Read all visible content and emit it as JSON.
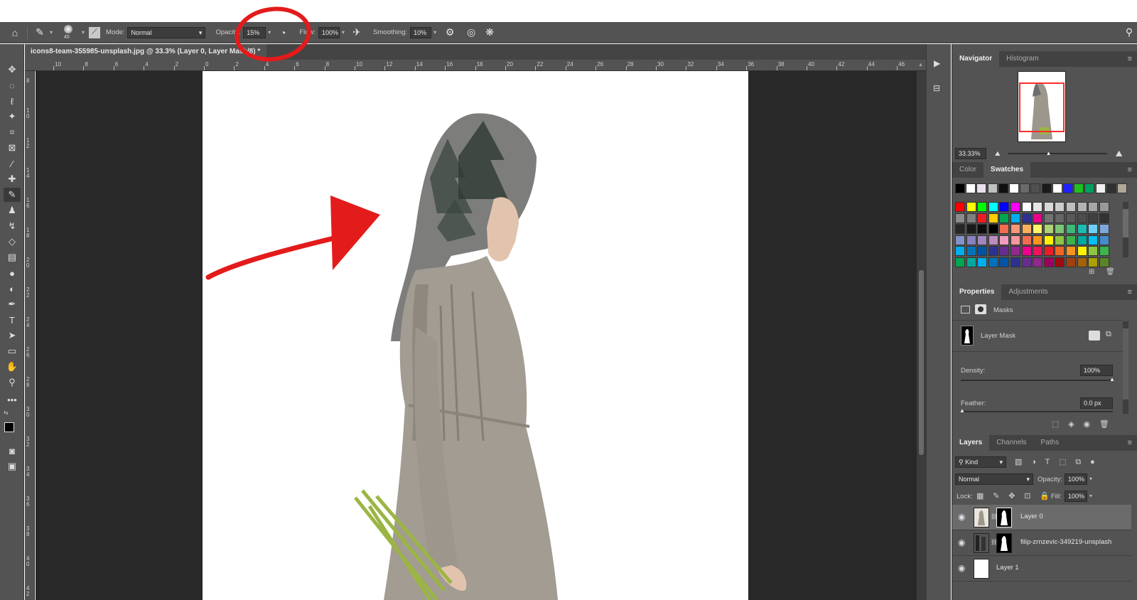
{
  "options_bar": {
    "brush_size": "45",
    "mode_label": "Mode:",
    "mode_value": "Normal",
    "opacity_label": "Opacity:",
    "opacity_value": "15%",
    "flow_label": "Flow:",
    "flow_value": "100%",
    "smoothing_label": "Smoothing:",
    "smoothing_value": "10%"
  },
  "document": {
    "tab_title": "icons8-team-355985-unsplash.jpg @ 33.3% (Layer 0, Layer Mask/8) *",
    "close_glyph": "×"
  },
  "ruler": {
    "h_ticks": [
      "10",
      "8",
      "6",
      "4",
      "2",
      "0",
      "2",
      "4",
      "6",
      "8",
      "10",
      "12",
      "14",
      "16",
      "18",
      "20",
      "22",
      "24",
      "26",
      "28",
      "30",
      "32",
      "34",
      "36",
      "38",
      "40",
      "42",
      "44",
      "46"
    ],
    "v_ticks": [
      "8",
      "1 0",
      "1 2",
      "1 4",
      "1 6",
      "1 8",
      "2 0",
      "2 2",
      "2 4",
      "2 6",
      "2 8",
      "3 0",
      "3 2",
      "3 4",
      "3 6",
      "3 8",
      "4 0",
      "4 2"
    ]
  },
  "navigator": {
    "tabs": [
      "Navigator",
      "Histogram"
    ],
    "zoom": "33.33%"
  },
  "color_panel": {
    "tabs": [
      "Color",
      "Swatches"
    ],
    "recent": [
      "#000000",
      "#ffffff",
      "#e8e0ea",
      "#c0c0c0",
      "#101010",
      "#ffffff",
      "#6a6a6a",
      "#505050",
      "#1a1a1a",
      "#ffffff",
      "#2020ff",
      "#20c020",
      "#00a060",
      "#f0f0f0",
      "#303030",
      "#b0a898"
    ],
    "grid": [
      [
        "#ff0000",
        "#ffff00",
        "#00ff00",
        "#00ffff",
        "#0000ff",
        "#ff00ff",
        "#ffffff",
        "#e6e6e6",
        "#d9d9d9",
        "#cccccc",
        "#bfbfbf",
        "#b3b3b3",
        "#a6a6a6",
        "#999999"
      ],
      [
        "#8c8c8c",
        "#808080",
        "#ed1c24",
        "#ffcc00",
        "#00a651",
        "#00aeef",
        "#2e3192",
        "#ec008c",
        "#737373",
        "#666666",
        "#595959",
        "#4d4d4d",
        "#404040",
        "#333333"
      ],
      [
        "#262626",
        "#1a1a1a",
        "#0d0d0d",
        "#000000",
        "#f26c4f",
        "#f69679",
        "#fbaf5d",
        "#fff568",
        "#acd373",
        "#7cc576",
        "#3cb878",
        "#1cbbb4",
        "#6dcff6",
        "#7da7d9"
      ],
      [
        "#8393ca",
        "#8781bd",
        "#a186be",
        "#bd8cbf",
        "#f49ac1",
        "#f5989d",
        "#f26c4f",
        "#f7941d",
        "#fff200",
        "#8dc63f",
        "#39b54a",
        "#00a99d",
        "#00bff3",
        "#448ccb"
      ],
      [
        "#00aeef",
        "#0072bc",
        "#0054a6",
        "#2e3192",
        "#662d91",
        "#92278f",
        "#ec008c",
        "#ed145b",
        "#ed1c24",
        "#f26522",
        "#f7941d",
        "#fff200",
        "#8dc63f",
        "#39b54a"
      ],
      [
        "#00a651",
        "#00a99d",
        "#00aeef",
        "#0072bc",
        "#0054a6",
        "#2e3192",
        "#662d91",
        "#92278f",
        "#9e005d",
        "#9e0b0f",
        "#a0410d",
        "#a36209",
        "#aba000",
        "#598527"
      ]
    ]
  },
  "properties": {
    "tabs": [
      "Properties",
      "Adjustments"
    ],
    "masks_label": "Masks",
    "layer_mask_label": "Layer Mask",
    "density_label": "Density:",
    "density_value": "100%",
    "feather_label": "Feather:",
    "feather_value": "0.0 px"
  },
  "layers": {
    "tabs": [
      "Layers",
      "Channels",
      "Paths"
    ],
    "kind": "Kind",
    "blend_mode": "Normal",
    "opacity_label": "Opacity:",
    "opacity_value": "100%",
    "lock_label": "Lock:",
    "fill_label": "Fill:",
    "fill_value": "100%",
    "items": [
      {
        "name": "Layer 0"
      },
      {
        "name": "filip-zrnzevic-349219-unsplash"
      },
      {
        "name": "Layer 1"
      }
    ]
  },
  "colors": {
    "annotation_red": "#e31b1b",
    "ui_dark": "#535353",
    "canvas_bg": "#282828"
  }
}
